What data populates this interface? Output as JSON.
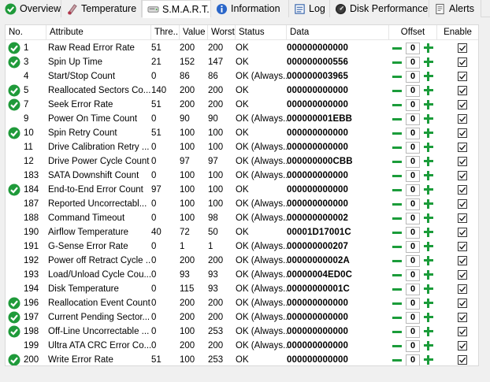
{
  "tabs": [
    {
      "label": "Overview",
      "icon": "ok-check-icon"
    },
    {
      "label": "Temperature",
      "icon": "thermometer-icon"
    },
    {
      "label": "S.M.A.R.T.",
      "icon": "smart-drive-icon"
    },
    {
      "label": "Information",
      "icon": "info-icon"
    },
    {
      "label": "Log",
      "icon": "log-icon"
    },
    {
      "label": "Disk Performance",
      "icon": "gauge-icon"
    },
    {
      "label": "Alerts",
      "icon": "alerts-icon"
    }
  ],
  "colors": {
    "ok_green": "#1f9a3a",
    "stepper_green": "#1b9c3a"
  },
  "columns": {
    "no": "No.",
    "attribute": "Attribute",
    "threshold": "Thre...",
    "value": "Value",
    "worst": "Worst",
    "status": "Status",
    "data": "Data",
    "offset": "Offset",
    "enable": "Enable"
  },
  "rows": [
    {
      "check": true,
      "no": "1",
      "attribute": "Raw Read Error Rate",
      "threshold": "51",
      "value": "200",
      "worst": "200",
      "status": "OK",
      "data": "000000000000",
      "offset": "0"
    },
    {
      "check": true,
      "no": "3",
      "attribute": "Spin Up Time",
      "threshold": "21",
      "value": "152",
      "worst": "147",
      "status": "OK",
      "data": "000000000556",
      "offset": "0"
    },
    {
      "check": false,
      "no": "4",
      "attribute": "Start/Stop Count",
      "threshold": "0",
      "value": "86",
      "worst": "86",
      "status": "OK (Always...",
      "data": "000000003965",
      "offset": "0"
    },
    {
      "check": true,
      "no": "5",
      "attribute": "Reallocated Sectors Co...",
      "threshold": "140",
      "value": "200",
      "worst": "200",
      "status": "OK",
      "data": "000000000000",
      "offset": "0"
    },
    {
      "check": true,
      "no": "7",
      "attribute": "Seek Error Rate",
      "threshold": "51",
      "value": "200",
      "worst": "200",
      "status": "OK",
      "data": "000000000000",
      "offset": "0"
    },
    {
      "check": false,
      "no": "9",
      "attribute": "Power On Time Count",
      "threshold": "0",
      "value": "90",
      "worst": "90",
      "status": "OK (Always...",
      "data": "000000001EBB",
      "offset": "0"
    },
    {
      "check": true,
      "no": "10",
      "attribute": "Spin Retry Count",
      "threshold": "51",
      "value": "100",
      "worst": "100",
      "status": "OK",
      "data": "000000000000",
      "offset": "0"
    },
    {
      "check": false,
      "no": "11",
      "attribute": "Drive Calibration Retry ...",
      "threshold": "0",
      "value": "100",
      "worst": "100",
      "status": "OK (Always...",
      "data": "000000000000",
      "offset": "0"
    },
    {
      "check": false,
      "no": "12",
      "attribute": "Drive Power Cycle Count",
      "threshold": "0",
      "value": "97",
      "worst": "97",
      "status": "OK (Always...",
      "data": "000000000CBB",
      "offset": "0"
    },
    {
      "check": false,
      "no": "183",
      "attribute": "SATA Downshift Count",
      "threshold": "0",
      "value": "100",
      "worst": "100",
      "status": "OK (Always...",
      "data": "000000000000",
      "offset": "0"
    },
    {
      "check": true,
      "no": "184",
      "attribute": "End-to-End Error Count",
      "threshold": "97",
      "value": "100",
      "worst": "100",
      "status": "OK",
      "data": "000000000000",
      "offset": "0"
    },
    {
      "check": false,
      "no": "187",
      "attribute": "Reported Uncorrectabl...",
      "threshold": "0",
      "value": "100",
      "worst": "100",
      "status": "OK (Always...",
      "data": "000000000000",
      "offset": "0"
    },
    {
      "check": false,
      "no": "188",
      "attribute": "Command Timeout",
      "threshold": "0",
      "value": "100",
      "worst": "98",
      "status": "OK (Always...",
      "data": "000000000002",
      "offset": "0"
    },
    {
      "check": false,
      "no": "190",
      "attribute": "Airflow Temperature",
      "threshold": "40",
      "value": "72",
      "worst": "50",
      "status": "OK",
      "data": "00001D17001C",
      "offset": "0"
    },
    {
      "check": false,
      "no": "191",
      "attribute": "G-Sense Error Rate",
      "threshold": "0",
      "value": "1",
      "worst": "1",
      "status": "OK (Always...",
      "data": "000000000207",
      "offset": "0"
    },
    {
      "check": false,
      "no": "192",
      "attribute": "Power off Retract Cycle ...",
      "threshold": "0",
      "value": "200",
      "worst": "200",
      "status": "OK (Always...",
      "data": "00000000002A",
      "offset": "0"
    },
    {
      "check": false,
      "no": "193",
      "attribute": "Load/Unload Cycle Cou...",
      "threshold": "0",
      "value": "93",
      "worst": "93",
      "status": "OK (Always...",
      "data": "00000004ED0C",
      "offset": "0"
    },
    {
      "check": false,
      "no": "194",
      "attribute": "Disk Temperature",
      "threshold": "0",
      "value": "115",
      "worst": "93",
      "status": "OK (Always...",
      "data": "00000000001C",
      "offset": "0"
    },
    {
      "check": true,
      "no": "196",
      "attribute": "Reallocation Event Count",
      "threshold": "0",
      "value": "200",
      "worst": "200",
      "status": "OK (Always...",
      "data": "000000000000",
      "offset": "0"
    },
    {
      "check": true,
      "no": "197",
      "attribute": "Current Pending Sector...",
      "threshold": "0",
      "value": "200",
      "worst": "200",
      "status": "OK (Always...",
      "data": "000000000000",
      "offset": "0"
    },
    {
      "check": true,
      "no": "198",
      "attribute": "Off-Line Uncorrectable ...",
      "threshold": "0",
      "value": "100",
      "worst": "253",
      "status": "OK (Always...",
      "data": "000000000000",
      "offset": "0"
    },
    {
      "check": false,
      "no": "199",
      "attribute": "Ultra ATA CRC Error Co...",
      "threshold": "0",
      "value": "200",
      "worst": "200",
      "status": "OK (Always...",
      "data": "000000000000",
      "offset": "0"
    },
    {
      "check": true,
      "no": "200",
      "attribute": "Write Error Rate",
      "threshold": "51",
      "value": "100",
      "worst": "253",
      "status": "OK",
      "data": "000000000000",
      "offset": "0"
    }
  ]
}
